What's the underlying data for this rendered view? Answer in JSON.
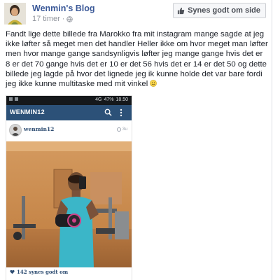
{
  "post": {
    "page_name": "Wenmin's Blog",
    "timestamp": "17 timer · ",
    "like_page_label": "Synes godt om side",
    "text": "Fandt lige dette billede fra Marokko fra mit instagram mange sagde at jeg ikke løfter så meget men det handler Heller ikke om hvor meget man løfter men hvor mange gange sandsynligvis løfter jeg mange gange hvis det er 8 er det 70 gange hvis det er 10 er det 56 hvis det er 14 er det 50 og dette billede jeg lagde på hvor det lignede jeg ik kunne holde det var bare fordi jeg ikke kunne multitaske med mit vinkel"
  },
  "photo": {
    "status_bar": {
      "network": "4G",
      "battery": "47%",
      "time": "18.50"
    },
    "app_title": "WENMIN12",
    "ig_username": "wenmin12",
    "ig_time": "3u",
    "ig_likes": "142 synes godt om"
  },
  "icons": {
    "globe": "globe-icon",
    "thumb": "thumbs-up-icon",
    "smiley": "smiley-emoji-icon",
    "search": "search-icon",
    "menu": "overflow-menu-icon",
    "clock": "clock-icon",
    "heart": "heart-icon"
  },
  "colors": {
    "page_name": "#3b5998",
    "app_bar": "#2c5178",
    "status_bar": "#15181b",
    "ig_link": "#2e4d72",
    "text": "#1d2129"
  }
}
